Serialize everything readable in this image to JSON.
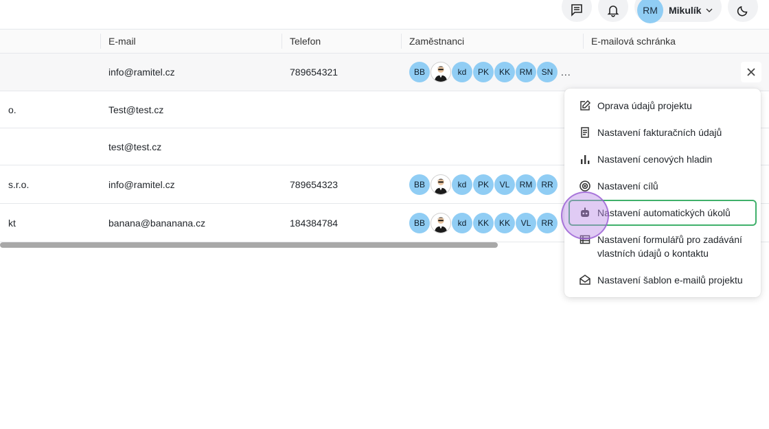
{
  "header": {
    "user": {
      "initials": "RM",
      "name": "Mikulík"
    }
  },
  "table": {
    "columns": [
      "E-mail",
      "Telefon",
      "Zaměstnanci",
      "E-mailová schránka"
    ],
    "rows": [
      {
        "name": "",
        "email": "info@ramitel.cz",
        "phone": "789654321",
        "employees": [
          "BB",
          "photo",
          "kd",
          "PK",
          "KK",
          "RM",
          "SN"
        ],
        "more": "..."
      },
      {
        "name": "o.",
        "email": "Test@test.cz",
        "phone": "",
        "employees": [],
        "more": ""
      },
      {
        "name": "",
        "email": "test@test.cz",
        "phone": "",
        "employees": [],
        "more": ""
      },
      {
        "name": " s.r.o.",
        "email": "info@ramitel.cz",
        "phone": "789654323",
        "employees": [
          "BB",
          "photo",
          "kd",
          "PK",
          "VL",
          "RM",
          "RR"
        ],
        "more": ""
      },
      {
        "name": "kt",
        "email": "banana@bananana.cz",
        "phone": "184384784",
        "employees": [
          "BB",
          "photo",
          "kd",
          "KK",
          "KK",
          "VL",
          "RR"
        ],
        "more": ""
      }
    ]
  },
  "menu": {
    "items": [
      {
        "label": "Oprava údajů projektu",
        "icon": "edit-icon"
      },
      {
        "label": "Nastavení fakturačních údajů",
        "icon": "invoice-icon"
      },
      {
        "label": "Nastavení cenových hladin",
        "icon": "bar-chart-icon"
      },
      {
        "label": "Nastavení cílů",
        "icon": "target-icon"
      },
      {
        "label": "Nastavení automatických úkolů",
        "icon": "robot-icon",
        "active": true
      },
      {
        "label": "Nastavení formulářů pro zadávání vlastních údajů o kontaktu",
        "icon": "table-icon"
      },
      {
        "label": "Nastavení šablon e-mailů projektu",
        "icon": "mail-icon"
      }
    ]
  },
  "colors": {
    "avatar": "#90cdf4",
    "active_border": "#3fb06a",
    "cursor_ring": "#bb8ce6"
  }
}
